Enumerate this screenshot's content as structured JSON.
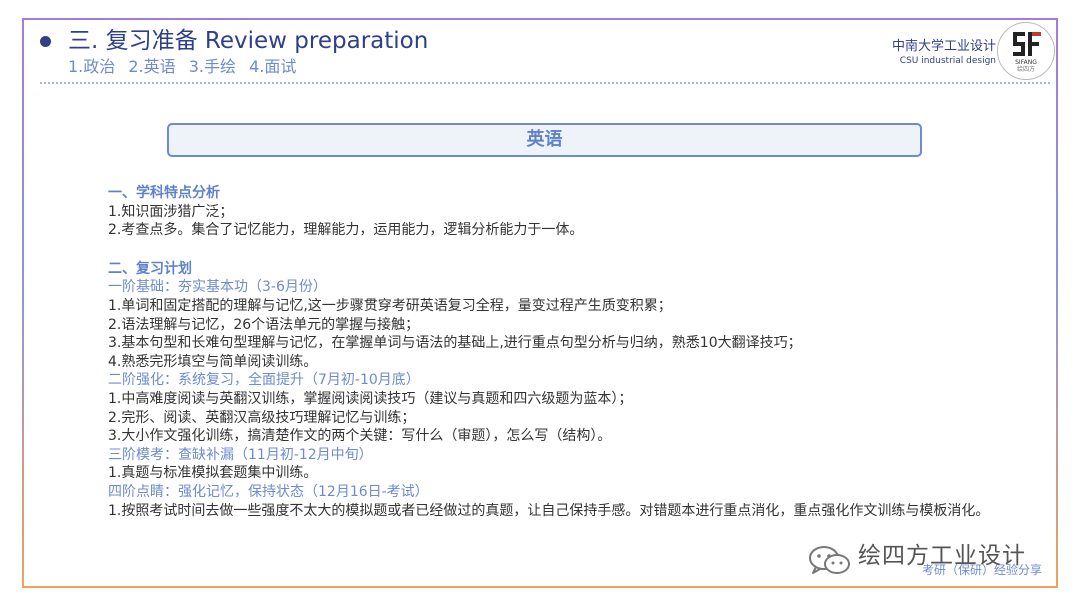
{
  "header": {
    "title": "三. 复习准备  Review preparation",
    "subtitle_items": [
      "1.政治",
      "2.英语",
      "3.手绘",
      "4.面试"
    ]
  },
  "brand": {
    "name_cn": "中南大学工业设计",
    "name_en": "CSU industrial design",
    "logo_caption": "SIFANG",
    "logo_caption2": "绘四方"
  },
  "banner": {
    "label": "英语"
  },
  "section1": {
    "heading": "一、学科特点分析",
    "lines": [
      "1.知识面涉猎广泛；",
      "2.考查点多。集合了记忆能力，理解能力，运用能力，逻辑分析能力于一体。"
    ]
  },
  "section2": {
    "heading": "二、复习计划",
    "phases": [
      {
        "title": "一阶基础：夯实基本功（3-6月份）",
        "lines": [
          "1.单词和固定搭配的理解与记忆,这一步骤贯穿考研英语复习全程，量变过程产生质变积累；",
          "2.语法理解与记忆，26个语法单元的掌握与接触；",
          "3.基本句型和长难句型理解与记忆，在掌握单词与语法的基础上,进行重点句型分析与归纳，熟悉10大翻译技巧；",
          "4.熟悉完形填空与简单阅读训练。"
        ]
      },
      {
        "title": "二阶强化：系统复习，全面提升（7月初-10月底）",
        "lines": [
          "1.中高难度阅读与英翻汉训练，掌握阅读阅读技巧（建议与真题和四六级题为蓝本）；",
          "2.完形、阅读、英翻汉高级技巧理解记忆与训练；",
          "3.大小作文强化训练，搞清楚作文的两个关键：写什么（审题），怎么写（结构）。"
        ]
      },
      {
        "title": "三阶模考：查缺补漏（11月初-12月中旬）",
        "lines": [
          "1.真题与标准模拟套题集中训练。"
        ]
      },
      {
        "title": "四阶点睛：强化记忆，保持状态（12月16日-考试）",
        "lines": [
          "1.按照考试时间去做一些强度不太大的模拟题或者已经做过的真题，让自己保持手感。对错题本进行重点消化，重点强化作文训练与模板消化。"
        ]
      }
    ]
  },
  "watermark": {
    "text": "绘四方工业设计",
    "sub": "考研（保研）经验分享"
  },
  "colors": {
    "title_navy": "#2f3f8a",
    "accent_blue": "#6d8bd0",
    "body_text": "#333333"
  }
}
